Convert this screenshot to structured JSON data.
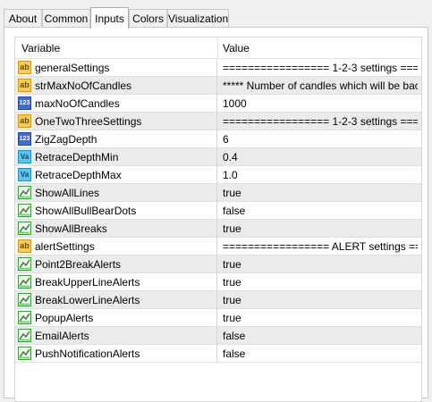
{
  "tabs": [
    "About",
    "Common",
    "Inputs",
    "Colors",
    "Visualization"
  ],
  "active_tab": "Inputs",
  "grid": {
    "header": {
      "variable": "Variable",
      "value": "Value"
    },
    "rows": [
      {
        "icon": "ab",
        "name": "generalSettings",
        "value": "================= 1-2-3 settings =====..."
      },
      {
        "icon": "ab",
        "name": "strMaxNoOfCandles",
        "value": "***** Number of candles which will be back ..."
      },
      {
        "icon": "num",
        "name": "maxNoOfCandles",
        "value": "1000"
      },
      {
        "icon": "ab",
        "name": "OneTwoThreeSettings",
        "value": "================= 1-2-3 settings =====..."
      },
      {
        "icon": "num",
        "name": "ZigZagDepth",
        "value": "6"
      },
      {
        "icon": "va",
        "name": "RetraceDepthMin",
        "value": "0.4"
      },
      {
        "icon": "va",
        "name": "RetraceDepthMax",
        "value": "1.0"
      },
      {
        "icon": "bool",
        "name": "ShowAllLines",
        "value": "true"
      },
      {
        "icon": "bool",
        "name": "ShowAllBullBearDots",
        "value": "false"
      },
      {
        "icon": "bool",
        "name": "ShowAllBreaks",
        "value": "true"
      },
      {
        "icon": "ab",
        "name": "alertSettings",
        "value": "================= ALERT settings ===..."
      },
      {
        "icon": "bool",
        "name": "Point2BreakAlerts",
        "value": "true"
      },
      {
        "icon": "bool",
        "name": "BreakUpperLineAlerts",
        "value": "true"
      },
      {
        "icon": "bool",
        "name": "BreakLowerLineAlerts",
        "value": "true"
      },
      {
        "icon": "bool",
        "name": "PopupAlerts",
        "value": "true"
      },
      {
        "icon": "bool",
        "name": "EmailAlerts",
        "value": "false"
      },
      {
        "icon": "bool",
        "name": "PushNotificationAlerts",
        "value": "false"
      }
    ]
  },
  "icon_glyphs": {
    "ab": "ab",
    "num": "123",
    "va": "Va"
  }
}
